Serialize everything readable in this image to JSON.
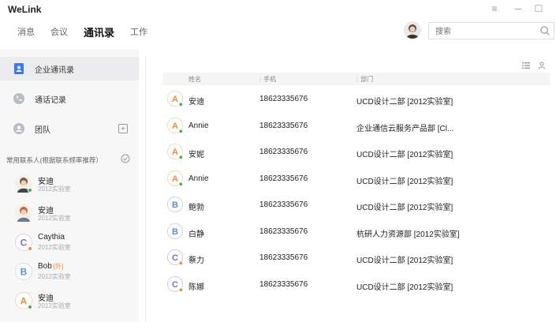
{
  "app": {
    "title": "WeLink"
  },
  "window": {
    "minimize": "─",
    "maximize": "☐",
    "menu": "≡"
  },
  "nav": {
    "items": [
      "消息",
      "会议",
      "通讯录",
      "工作"
    ]
  },
  "search": {
    "placeholder": "搜索"
  },
  "sidebar": {
    "items": [
      {
        "label": "企业通讯录",
        "icon": "directory-icon"
      },
      {
        "label": "通话记录",
        "icon": "call-log-icon"
      },
      {
        "label": "团队",
        "icon": "team-icon"
      }
    ],
    "team_add": "+",
    "frequent_header": "常用联系人(根据联系频率推荐）",
    "contacts": [
      {
        "name": "安迪",
        "sub": "2012实验室",
        "tag": "",
        "avatar": "photo",
        "color": "#7a5a48"
      },
      {
        "name": "安迪",
        "sub": "2012实验室",
        "tag": "",
        "avatar": "photo",
        "color": "#c9643c"
      },
      {
        "name": "Caythia",
        "sub": "2012实验室",
        "tag": "",
        "avatar": "C",
        "color": "#7b6bd6"
      },
      {
        "name": "Bob",
        "sub": "2012实验室",
        "tag": "[外]",
        "avatar": "B",
        "color": "#5b8fd6"
      },
      {
        "name": "安迪",
        "sub": "2012实验室",
        "tag": "",
        "avatar": "A",
        "color": "#f08a3a"
      }
    ]
  },
  "table": {
    "headers": [
      "姓名",
      "手机",
      "部门"
    ],
    "rows": [
      {
        "avatar": "A",
        "color": "#f08a3a",
        "name": "安迪",
        "phone": "18623335676",
        "dept": "UCD设计二部 [2012实验室]"
      },
      {
        "avatar": "A",
        "color": "#f08a3a",
        "name": "Annie",
        "phone": "18623335676",
        "dept": "企业通信云服务产品部 [Cl..."
      },
      {
        "avatar": "A",
        "color": "#f08a3a",
        "name": "安妮",
        "phone": "18623335676",
        "dept": "UCD设计二部 [2012实验室]"
      },
      {
        "avatar": "A",
        "color": "#f08a3a",
        "name": "Annie",
        "phone": "18623335676",
        "dept": "UCD设计二部 [2012实验室]"
      },
      {
        "avatar": "B",
        "color": "#5b8fd6",
        "name": "鲍勃",
        "phone": "18623335676",
        "dept": "UCD设计二部 [2012实验室]"
      },
      {
        "avatar": "B",
        "color": "#5b8fd6",
        "name": "白静",
        "phone": "18623335676",
        "dept": "杭研人力资源部 [2012实验室]"
      },
      {
        "avatar": "C",
        "color": "#7b6bd6",
        "name": "蔡力",
        "phone": "18623335676",
        "dept": "UCD设计二部 [2012实验室]"
      },
      {
        "avatar": "C",
        "color": "#7b6bd6",
        "name": "陈娜",
        "phone": "18623335676",
        "dept": "UCD设计二部 [2012实验室]"
      }
    ]
  },
  "colors": {
    "accent": "#3a7de0",
    "online": "#3bb54a",
    "sidebar_bg": "#f7f7f8"
  }
}
